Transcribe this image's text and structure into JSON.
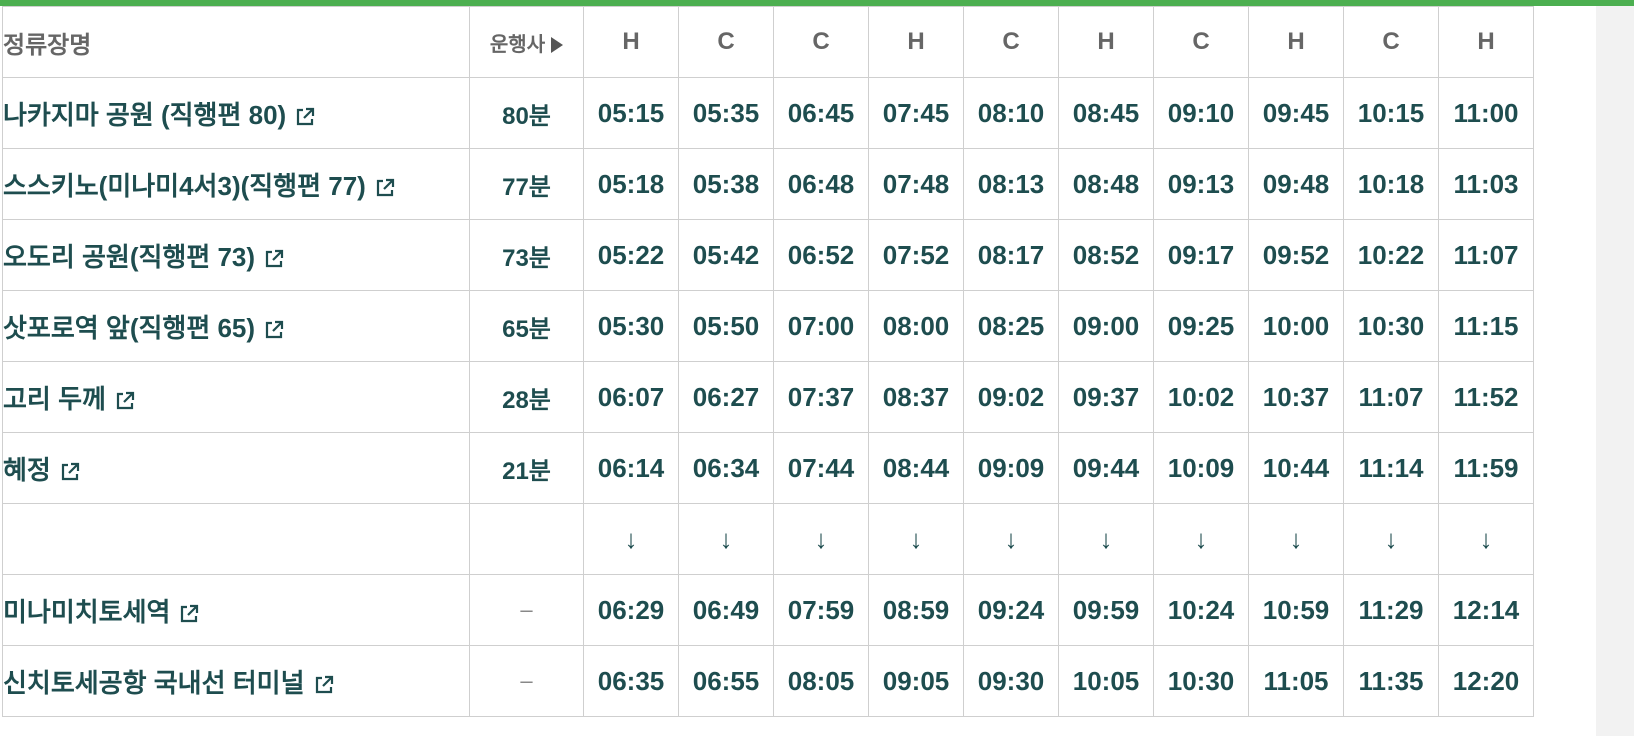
{
  "header": {
    "stop_name": "정류장명",
    "operator": "운행사",
    "operator_icon": "triangle-right-icon",
    "operators": [
      "H",
      "C",
      "C",
      "H",
      "C",
      "H",
      "C",
      "H",
      "C",
      "H"
    ]
  },
  "stops": [
    {
      "name": "나카지마 공원 (직행편 80)",
      "duration": "80분",
      "link_icon": "external-link-icon",
      "times": [
        "05:15",
        "05:35",
        "06:45",
        "07:45",
        "08:10",
        "08:45",
        "09:10",
        "09:45",
        "10:15",
        "11:00"
      ]
    },
    {
      "name": "스스키노(미나미4서3)(직행편 77)",
      "duration": "77분",
      "link_icon": "external-link-icon",
      "times": [
        "05:18",
        "05:38",
        "06:48",
        "07:48",
        "08:13",
        "08:48",
        "09:13",
        "09:48",
        "10:18",
        "11:03"
      ]
    },
    {
      "name": "오도리 공원(직행편 73)",
      "duration": "73분",
      "link_icon": "external-link-icon",
      "times": [
        "05:22",
        "05:42",
        "06:52",
        "07:52",
        "08:17",
        "08:52",
        "09:17",
        "09:52",
        "10:22",
        "11:07"
      ]
    },
    {
      "name": "삿포로역 앞(직행편 65)",
      "duration": "65분",
      "link_icon": "external-link-icon",
      "times": [
        "05:30",
        "05:50",
        "07:00",
        "08:00",
        "08:25",
        "09:00",
        "09:25",
        "10:00",
        "10:30",
        "11:15"
      ]
    },
    {
      "name": "고리 두께",
      "duration": "28분",
      "link_icon": "external-link-icon",
      "times": [
        "06:07",
        "06:27",
        "07:37",
        "08:37",
        "09:02",
        "09:37",
        "10:02",
        "10:37",
        "11:07",
        "11:52"
      ]
    },
    {
      "name": "혜정",
      "duration": "21분",
      "link_icon": "external-link-icon",
      "times": [
        "06:14",
        "06:34",
        "07:44",
        "08:44",
        "09:09",
        "09:44",
        "10:09",
        "10:44",
        "11:14",
        "11:59"
      ]
    }
  ],
  "arrow_row": {
    "symbol": "↓"
  },
  "arrivals": [
    {
      "name": "미나미치토세역",
      "duration": "–",
      "link_icon": "external-link-icon",
      "times": [
        "06:29",
        "06:49",
        "07:59",
        "08:59",
        "09:24",
        "09:59",
        "10:24",
        "10:59",
        "11:29",
        "12:14"
      ]
    },
    {
      "name": "신치토세공항 국내선 터미널",
      "duration": "–",
      "link_icon": "external-link-icon",
      "times": [
        "06:35",
        "06:55",
        "08:05",
        "09:05",
        "09:30",
        "10:05",
        "10:30",
        "11:05",
        "11:35",
        "12:20"
      ]
    }
  ],
  "colors": {
    "accent": "#4caf50",
    "text": "#1e4d4f",
    "header_text": "#666666",
    "border": "#cfcfcf"
  }
}
